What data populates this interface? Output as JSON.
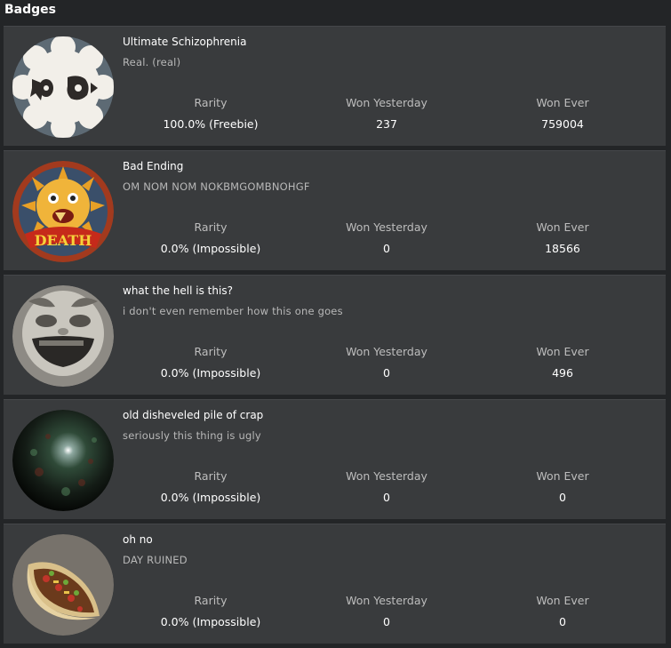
{
  "header": {
    "title": "Badges"
  },
  "labels": {
    "rarity": "Rarity",
    "won_yesterday": "Won Yesterday",
    "won_ever": "Won Ever"
  },
  "badges": [
    {
      "name": "Ultimate Schizophrenia",
      "description": "Real. (real)",
      "rarity": "100.0% (Freebie)",
      "won_yesterday": "237",
      "won_ever": "759004",
      "icon": "eyes-cloud-icon"
    },
    {
      "name": "Bad Ending",
      "description": "OM NOM NOM NOKBMGOMBNOHGF",
      "rarity": "0.0% (Impossible)",
      "won_yesterday": "0",
      "won_ever": "18566",
      "icon": "death-sun-icon"
    },
    {
      "name": "what the hell is this?",
      "description": "i don't even remember how this one goes",
      "rarity": "0.0% (Impossible)",
      "won_yesterday": "0",
      "won_ever": "496",
      "icon": "face-blur-icon"
    },
    {
      "name": "old disheveled pile of crap",
      "description": "seriously this thing is ugly",
      "rarity": "0.0% (Impossible)",
      "won_yesterday": "0",
      "won_ever": "0",
      "icon": "dark-orb-icon"
    },
    {
      "name": "oh no",
      "description": "DAY RUINED",
      "rarity": "0.0% (Impossible)",
      "won_yesterday": "0",
      "won_ever": "0",
      "icon": "taco-icon"
    }
  ]
}
